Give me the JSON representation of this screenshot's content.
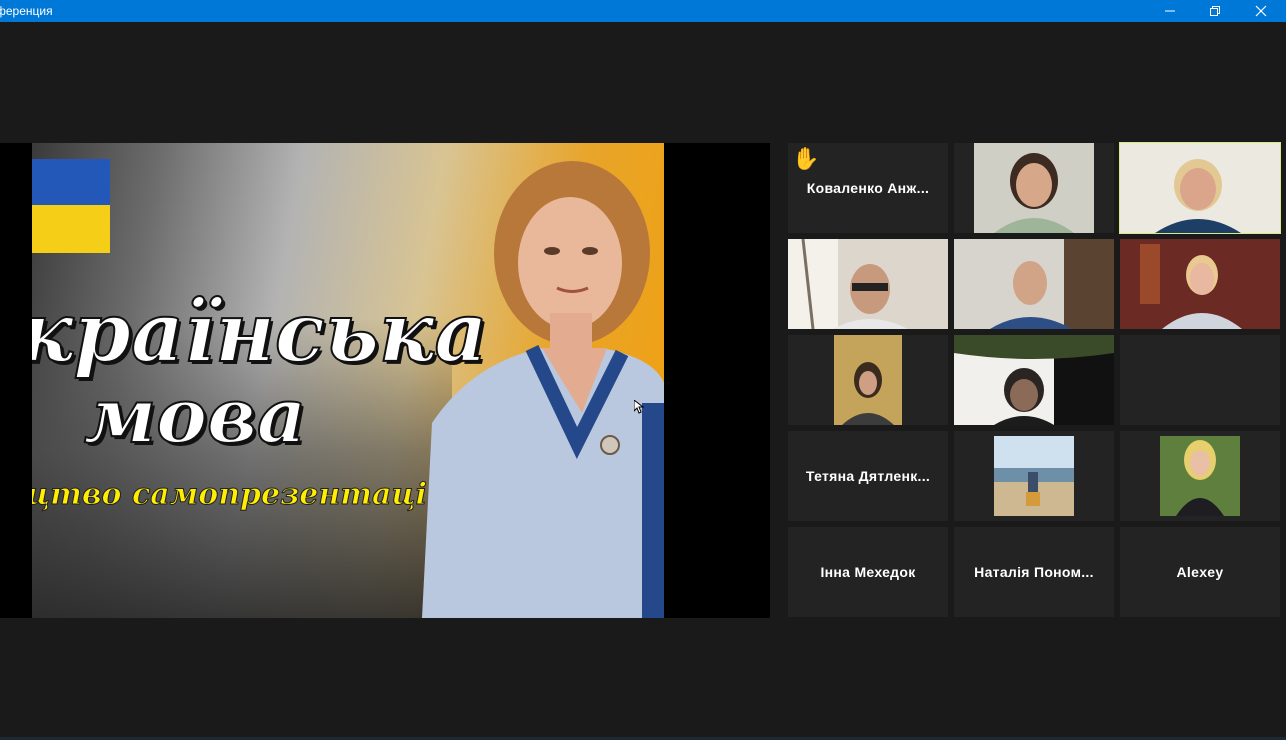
{
  "window": {
    "title": "ференция",
    "minimize_icon": "minimize-icon",
    "restore_icon": "restore-icon",
    "close_icon": "close-icon",
    "accent": "#0078d7"
  },
  "shared_screen": {
    "title_line1": "країнська",
    "title_line2": "мова",
    "subtitle": "цтво самопрезентації",
    "flag_colors": [
      "#2358b8",
      "#f5cf17"
    ]
  },
  "participants": [
    {
      "name": "Коваленко Анж...",
      "video": false,
      "hand_raised": true
    },
    {
      "name": "",
      "video": true
    },
    {
      "name": "",
      "video": true,
      "active_speaker": true
    },
    {
      "name": "",
      "video": true
    },
    {
      "name": "",
      "video": true
    },
    {
      "name": "",
      "video": true
    },
    {
      "name": "",
      "video": true
    },
    {
      "name": "",
      "video": true
    },
    {
      "name": "",
      "video": false
    },
    {
      "name": "Тетяна Дятленк...",
      "video": false
    },
    {
      "name": "",
      "video": true
    },
    {
      "name": "",
      "video": true
    },
    {
      "name": "Інна Мехедок",
      "video": false
    },
    {
      "name": "Наталія Поном...",
      "video": false
    },
    {
      "name": "Alexey",
      "video": false
    }
  ],
  "speaker_highlight_color": "#d8e98b"
}
